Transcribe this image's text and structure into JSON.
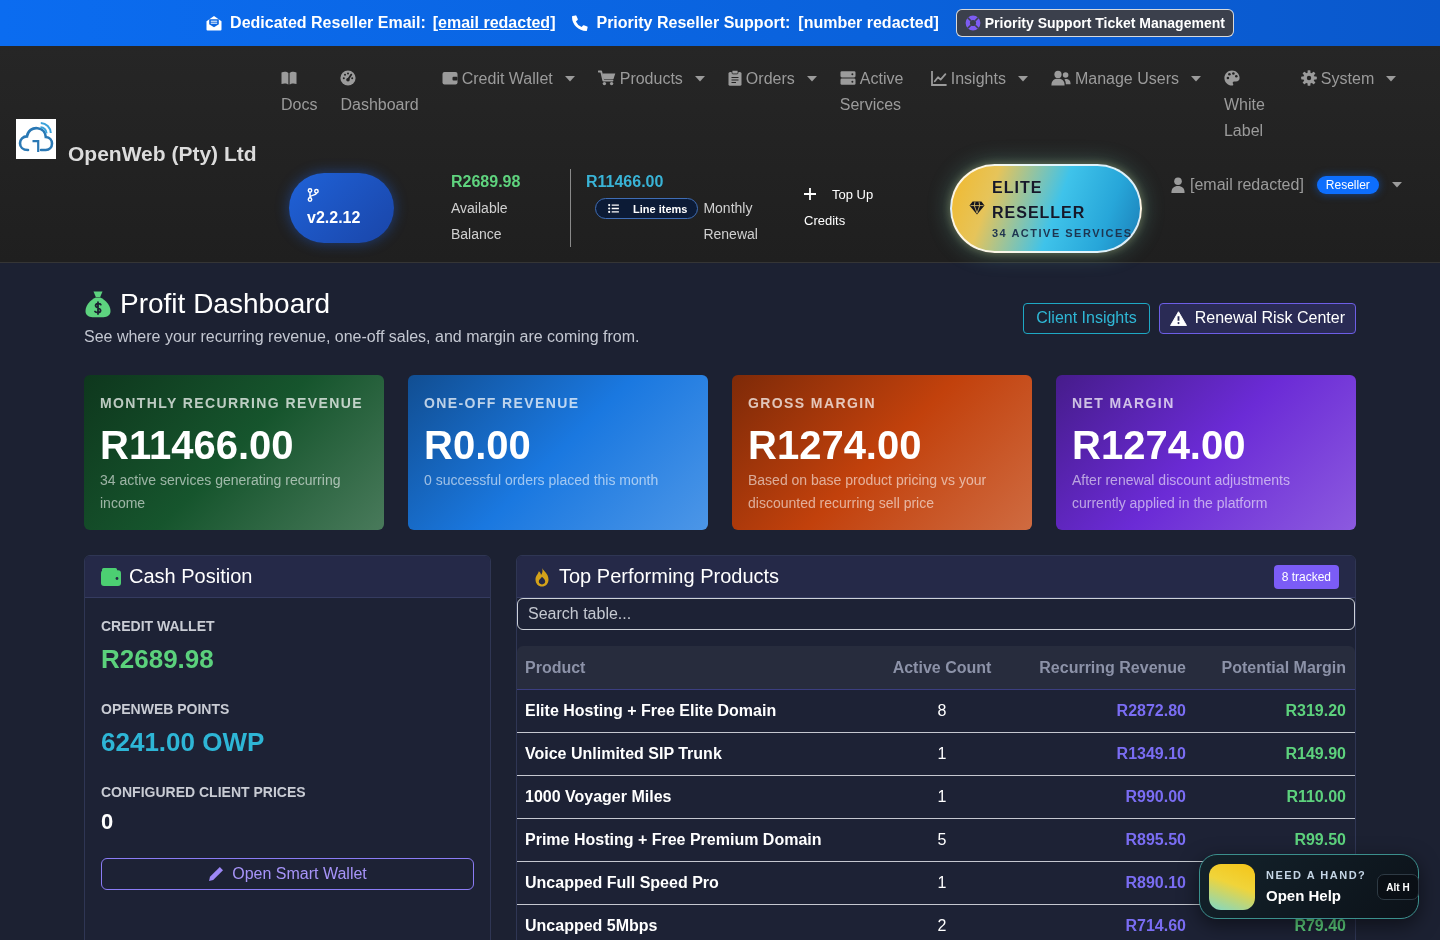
{
  "top_bar": {
    "email_label": "Dedicated Reseller Email:",
    "email": "[email redacted]",
    "support_label": "Priority Reseller Support:",
    "support_number": "[number redacted]",
    "ticket_button": "Priority Support Ticket Management"
  },
  "brand": {
    "name": "OpenWeb (Pty) Ltd"
  },
  "nav": [
    {
      "label": "Docs",
      "dropdown": false
    },
    {
      "label": "Dashboard",
      "dropdown": false
    },
    {
      "label": "Credit Wallet",
      "dropdown": true
    },
    {
      "label": "Products",
      "dropdown": true
    },
    {
      "label": "Orders",
      "dropdown": true
    },
    {
      "label": "Active Services",
      "dropdown": false
    },
    {
      "label": "Insights",
      "dropdown": true
    },
    {
      "label": "Manage Users",
      "dropdown": true
    },
    {
      "label": "White Label",
      "dropdown": false
    },
    {
      "label": "System",
      "dropdown": true
    }
  ],
  "account_bar": {
    "version": "v2.2.12",
    "balance": {
      "amount": "R2689.98",
      "label": "Available Balance"
    },
    "renewal": {
      "amount": "R11466.00",
      "button": "Line items",
      "label": "Monthly Renewal"
    },
    "top_up": "Top Up Credits",
    "tier": {
      "title": "ELITE RESELLER",
      "subtitle": "34 ACTIVE SERVICES"
    },
    "user": {
      "email": "[email redacted]",
      "role": "Reseller"
    }
  },
  "page_header": {
    "title": "Profit Dashboard",
    "subtitle": "See where your recurring revenue, one-off sales, and margin are coming from.",
    "buttons": [
      {
        "label": "Client Insights",
        "kind": "outline"
      },
      {
        "label": "Renewal Risk Center",
        "kind": "warning"
      }
    ]
  },
  "stats": [
    {
      "label": "MONTHLY RECURRING REVENUE",
      "value": "R11466.00",
      "note": "34 active services generating recurring income",
      "color": "#16552d"
    },
    {
      "label": "ONE-OFF REVENUE",
      "value": "R0.00",
      "note": "0 successful orders placed this month",
      "color": "#1a78e0"
    },
    {
      "label": "GROSS MARGIN",
      "value": "R1274.00",
      "note": "Based on base product pricing vs your discounted recurring sell price",
      "color": "#c2410c"
    },
    {
      "label": "NET MARGIN",
      "value": "R1274.00",
      "note": "After renewal discount adjustments currently applied in the platform",
      "color": "#6b2bd6"
    }
  ],
  "cash_position": {
    "title": "Cash Position",
    "items": [
      {
        "label": "CREDIT WALLET",
        "value": "R2689.98",
        "kind": "money"
      },
      {
        "label": "OPENWEB POINTS",
        "value": "6241.00 OWP",
        "kind": "points"
      },
      {
        "label": "CONFIGURED CLIENT PRICES",
        "value": "0",
        "kind": "count"
      }
    ],
    "button": "Open Smart Wallet"
  },
  "top_products": {
    "title": "Top Performing Products",
    "badge": "8 tracked",
    "search": {
      "placeholder": "Search table..."
    },
    "columns": [
      "Product",
      "Active Count",
      "Recurring Revenue",
      "Potential Margin"
    ],
    "rows": [
      [
        "Elite Hosting + Free Elite Domain",
        "8",
        "R2872.80",
        "R319.20"
      ],
      [
        "Voice Unlimited SIP Trunk",
        "1",
        "R1349.10",
        "R149.90"
      ],
      [
        "1000 Voyager Miles",
        "1",
        "R990.00",
        "R110.00"
      ],
      [
        "Prime Hosting + Free Premium Domain",
        "5",
        "R895.50",
        "R99.50"
      ],
      [
        "Uncapped Full Speed Pro",
        "1",
        "R890.10"
      ],
      [
        "Uncapped 5Mbps",
        "2",
        "R714.60",
        "R79.40"
      ]
    ]
  },
  "help": {
    "eyebrow": "NEED A HAND?",
    "label": "Open Help",
    "shortcut": "Alt H"
  }
}
